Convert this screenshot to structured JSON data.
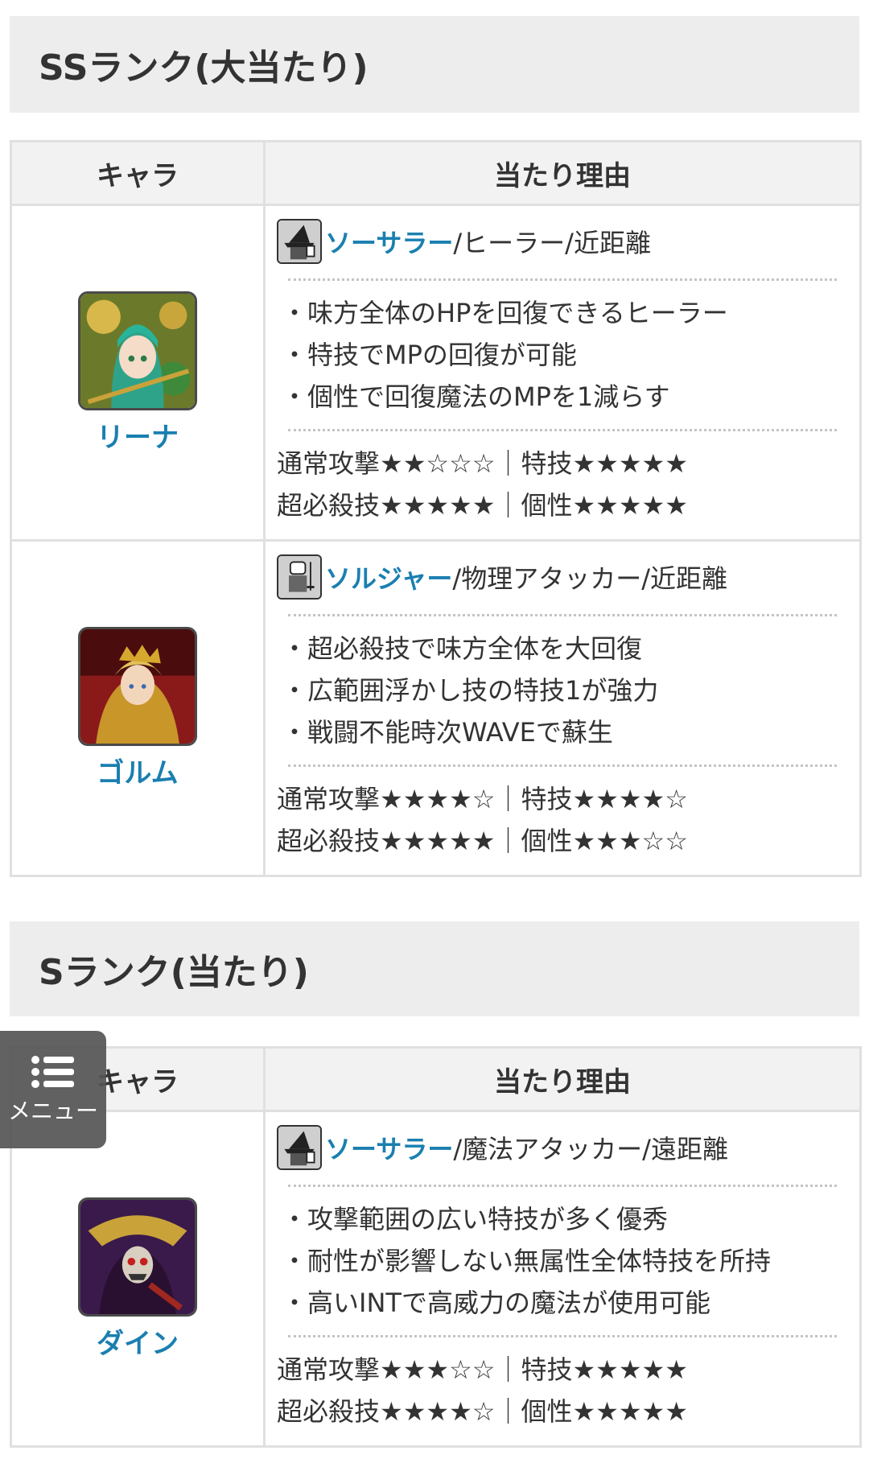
{
  "sections": [
    {
      "heading": "SSランク(大当たり)",
      "col_char": "キャラ",
      "col_reason": "当たり理由",
      "rows": [
        {
          "name": "リーナ",
          "portrait_icon": "portrait-rina",
          "class_icon": "sorcerer-icon",
          "class_name": "ソーサラー",
          "role": "/ヒーラー/近距離",
          "bullets": [
            "味方全体のHPを回復できるヒーラー",
            "特技でMPの回復が可能",
            "個性で回復魔法のMPを1減らす"
          ],
          "rating_line1": "通常攻撃★★☆☆☆｜特技★★★★★",
          "rating_line2": "超必殺技★★★★★｜個性★★★★★"
        },
        {
          "name": "ゴルム",
          "portrait_icon": "portrait-golm",
          "class_icon": "soldier-icon",
          "class_name": "ソルジャー",
          "role": "/物理アタッカー/近距離",
          "bullets": [
            "超必殺技で味方全体を大回復",
            "広範囲浮かし技の特技1が強力",
            "戦闘不能時次WAVEで蘇生"
          ],
          "rating_line1": "通常攻撃★★★★☆｜特技★★★★☆",
          "rating_line2": "超必殺技★★★★★｜個性★★★☆☆"
        }
      ]
    },
    {
      "heading": "Sランク(当たり)",
      "col_char": "キャラ",
      "col_reason": "当たり理由",
      "rows": [
        {
          "name": "ダイン",
          "portrait_icon": "portrait-dain",
          "class_icon": "sorcerer-icon",
          "class_name": "ソーサラー",
          "role": "/魔法アタッカー/遠距離",
          "bullets": [
            "攻撃範囲の広い特技が多く優秀",
            "耐性が影響しない無属性全体特技を所持",
            "高いINTで高威力の魔法が使用可能"
          ],
          "rating_line1": "通常攻撃★★★☆☆｜特技★★★★★",
          "rating_line2": "超必殺技★★★★☆｜個性★★★★★"
        }
      ]
    }
  ],
  "menu": {
    "label": "メニュー",
    "icon": "list-menu-icon"
  },
  "colors": {
    "link": "#1a7fb0",
    "heading_bg": "#ededed",
    "header_bg": "#f2f2f2",
    "border": "#e0e0e0"
  }
}
